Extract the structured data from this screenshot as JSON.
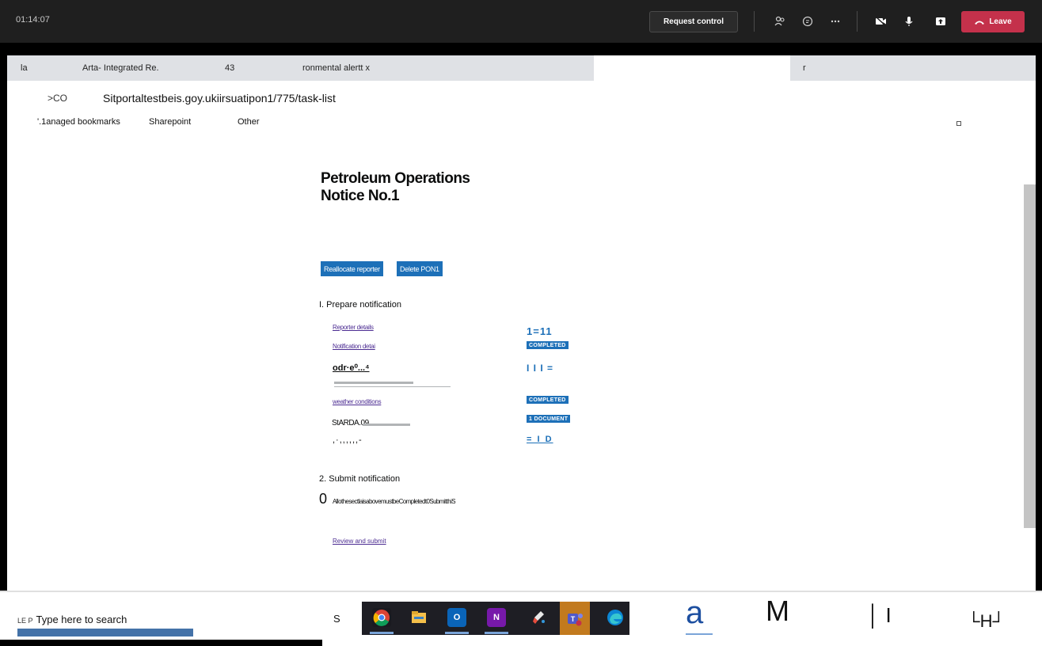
{
  "teams": {
    "timer": "01:14:07",
    "request_control": "Request control",
    "leave": "Leave",
    "icons": [
      "people-icon",
      "chat-icon",
      "more-icon",
      "camera-off-icon",
      "mic-icon",
      "share-icon"
    ]
  },
  "browser": {
    "tabs": [
      {
        "label": "la"
      },
      {
        "label": "Arta- Integrated Re."
      },
      {
        "label": "43"
      },
      {
        "label": "ronmental alertt x"
      },
      {
        "label": "r"
      }
    ],
    "nav": ">CO",
    "url": "Sitportaltestbeis.goy.ukiirsuatipon1/775/task-list",
    "bookmarks": [
      "'.1anaged bookmarks",
      "Sharepoint",
      "Other"
    ]
  },
  "page": {
    "title_line1": "Petroleum Operations",
    "title_line2": "Notice No.1",
    "buttons": {
      "reallocate": "Reallocate reporter",
      "delete": "Delete PON1"
    },
    "section1": {
      "heading": "I. Prepare notification",
      "tasks": [
        {
          "label": "Reporter details",
          "status": "1=11"
        },
        {
          "label": "Notification detai",
          "status": "COMPLETED"
        },
        {
          "label": "odr·e⁰...⁴",
          "status": "I I I ="
        },
        {
          "label": "weather conditions",
          "status": "COMPLETED"
        },
        {
          "label": "StARDA.09",
          "status": "1 DOCUMENT"
        },
        {
          "label": ",·,,,,,,-",
          "status": "= I D"
        }
      ]
    },
    "section2": {
      "heading": "2. Submit notification",
      "marker": "0",
      "note": "AllothesectlaisabovemustbeCompletedt0SubmitthiS",
      "review_link": "Review and submit"
    }
  },
  "taskbar": {
    "search_prefix": "LE P",
    "search_text": "Type here to search",
    "s_letter": "S",
    "apps": [
      "chrome-icon",
      "file-explorer-icon",
      "outlook-icon",
      "onenote-icon",
      "paint-icon",
      "teams-icon",
      "edge-icon"
    ],
    "big_a": "a",
    "big_m": "M",
    "tray_a": "│ I",
    "tray_b": "└H┘"
  }
}
